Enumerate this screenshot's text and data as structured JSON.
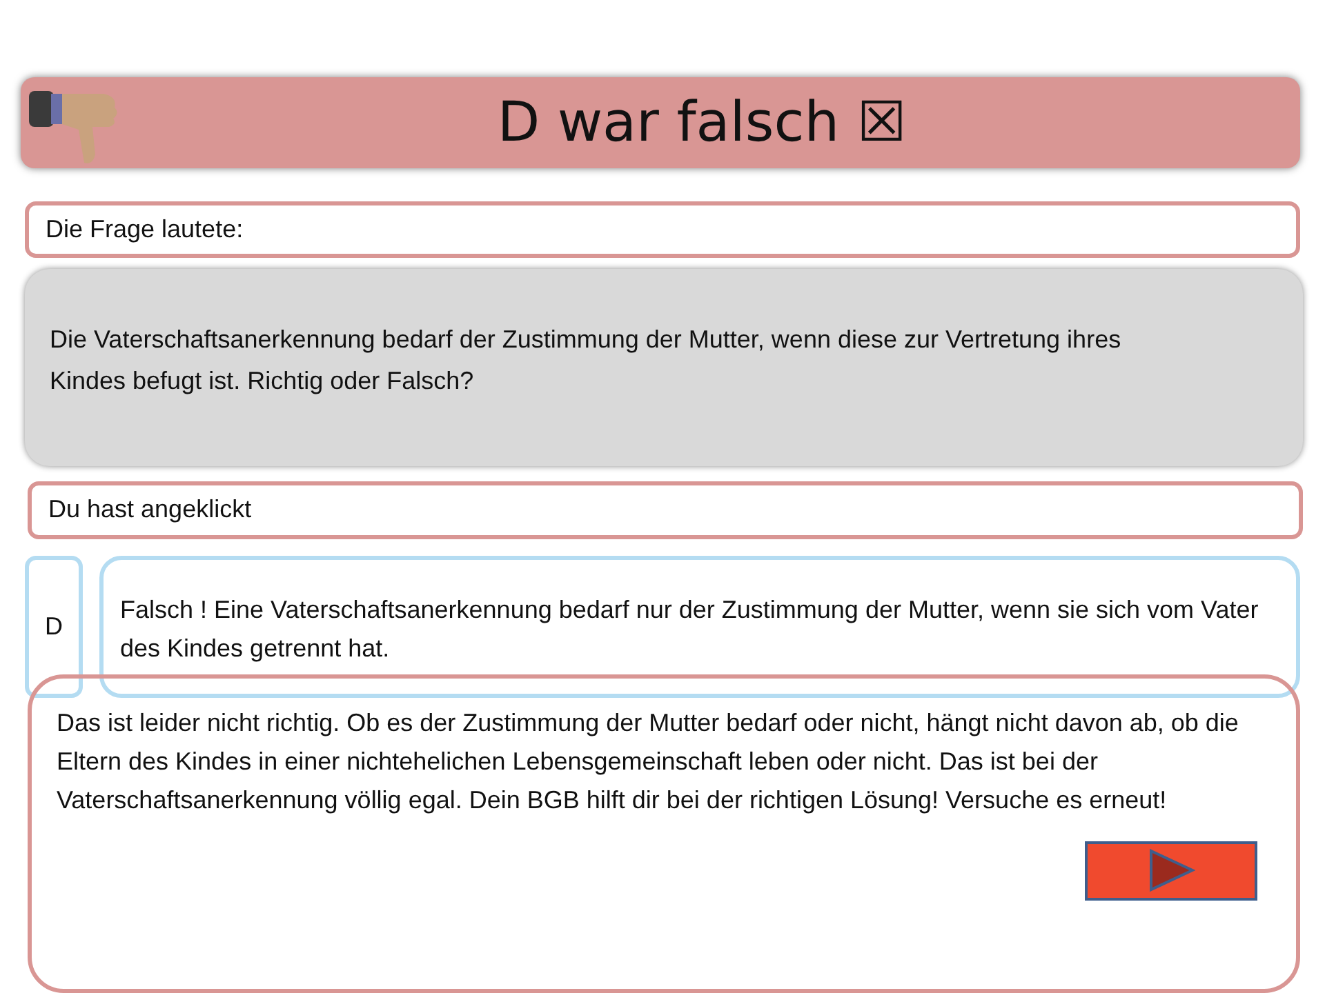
{
  "header": {
    "title": "D war falsch ☒"
  },
  "question_label": "Die Frage lautete:",
  "question": "Die Vaterschaftsanerkennung bedarf der Zustimmung der Mutter, wenn diese zur Vertretung ihres Kindes befugt ist. Richtig oder Falsch?",
  "answer_label": "Du hast angeklickt",
  "answer": {
    "letter": "D",
    "text": "Falsch ! Eine Vaterschaftsanerkennung bedarf nur der Zustimmung der Mutter, wenn sie sich vom Vater des Kindes getrennt hat."
  },
  "feedback": "Das ist leider nicht richtig. Ob es der Zustimmung der Mutter bedarf oder nicht, hängt nicht davon ab, ob die Eltern des Kindes in einer nichtehelichen Lebensgemeinschaft leben oder nicht. Das ist bei der Vaterschaftsanerkennung völlig egal. Dein BGB hilft dir bei der richtigen Lösung! Versuche es erneut!"
}
